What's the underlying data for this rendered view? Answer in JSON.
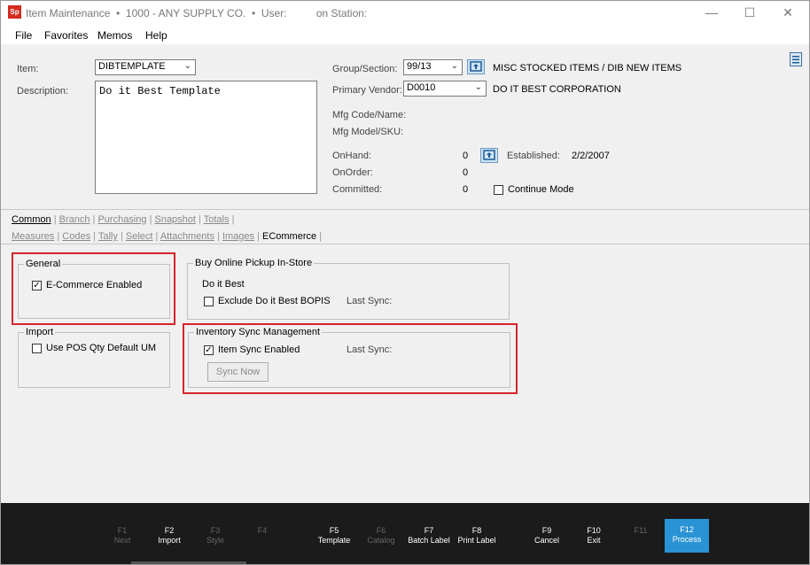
{
  "window": {
    "logo": "Sp",
    "title": "Item Maintenance  •  1000 - ANY SUPPLY CO.  •  User:          on Station:"
  },
  "menu": [
    "File",
    "Favorites",
    "Memos",
    "Help"
  ],
  "header": {
    "item_label": "Item:",
    "item_value": "DIBTEMPLATE",
    "description_label": "Description:",
    "description_value": "Do it Best Template",
    "group_label": "Group/Section:",
    "group_value": "99/13",
    "group_desc": "MISC STOCKED ITEMS / DIB NEW ITEMS",
    "vendor_label": "Primary Vendor:",
    "vendor_value": "D0010",
    "vendor_desc": "DO IT BEST CORPORATION",
    "mfg_code_label": "Mfg Code/Name:",
    "mfg_model_label": "Mfg Model/SKU:",
    "onhand_label": "OnHand:",
    "onhand_value": "0",
    "onorder_label": "OnOrder:",
    "onorder_value": "0",
    "committed_label": "Committed:",
    "committed_value": "0",
    "established_label": "Established:",
    "established_value": "2/2/2007",
    "continue_mode_label": "Continue Mode"
  },
  "tabs_row1": [
    "Common",
    "Branch",
    "Purchasing",
    "Snapshot",
    "Totals"
  ],
  "tabs_row2": [
    "Measures",
    "Codes",
    "Tally",
    "Select",
    "Attachments",
    "Images",
    "ECommerce"
  ],
  "ecommerce": {
    "general_title": "General",
    "ecommerce_enabled_label": "E-Commerce Enabled",
    "ecommerce_enabled": true,
    "import_title": "Import",
    "use_pos_qty_label": "Use POS Qty Default UM",
    "use_pos_qty": false,
    "bopis_title": "Buy Online Pickup In-Store",
    "bopis_vendor": "Do it Best",
    "exclude_bopis_label": "Exclude Do it Best BOPIS",
    "exclude_bopis": false,
    "bopis_last_sync_label": "Last Sync:",
    "inventory_title": "Inventory Sync Management",
    "item_sync_label": "Item Sync Enabled",
    "item_sync": true,
    "inventory_last_sync_label": "Last Sync:",
    "sync_now_label": "Sync Now"
  },
  "fkeys": [
    {
      "key": "F1",
      "label": "Next"
    },
    {
      "key": "F2",
      "label": "Import"
    },
    {
      "key": "F3",
      "label": "Style"
    },
    {
      "key": "F4",
      "label": ""
    },
    {
      "key": "F5",
      "label": "Template"
    },
    {
      "key": "F6",
      "label": "Catalog"
    },
    {
      "key": "F7",
      "label": "Batch Label"
    },
    {
      "key": "F8",
      "label": "Print Label"
    },
    {
      "key": "F9",
      "label": "Cancel"
    },
    {
      "key": "F10",
      "label": "Exit"
    },
    {
      "key": "F11",
      "label": ""
    },
    {
      "key": "F12",
      "label": "Process"
    }
  ],
  "colors": {
    "highlight_box": "#d4262a",
    "process_key": "#2a93d5",
    "footer_bg": "#1b1b1b"
  }
}
